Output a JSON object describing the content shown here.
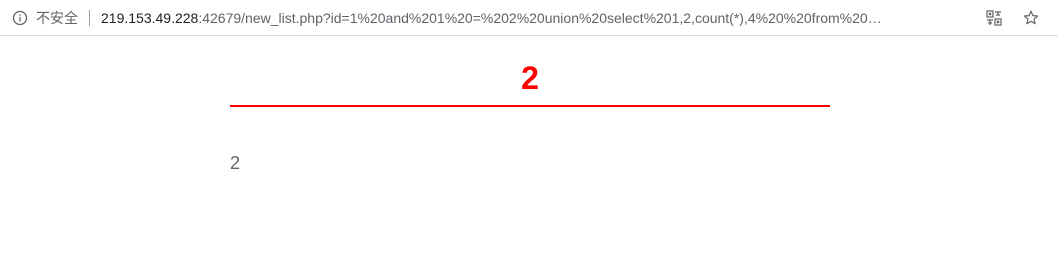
{
  "browser": {
    "security_label": "不安全",
    "url_host": "219.153.49.228",
    "url_rest": ":42679/new_list.php?id=1%20and%201%20=%202%20union%20select%201,2,count(*),4%20%20from%20…",
    "icons": {
      "info": "info-icon",
      "translate": "translate-icon",
      "bookmark": "star-icon"
    }
  },
  "page": {
    "heading": "2",
    "content": "2",
    "colors": {
      "heading": "#ff0000",
      "rule": "#ff0000",
      "content": "#666666"
    }
  }
}
